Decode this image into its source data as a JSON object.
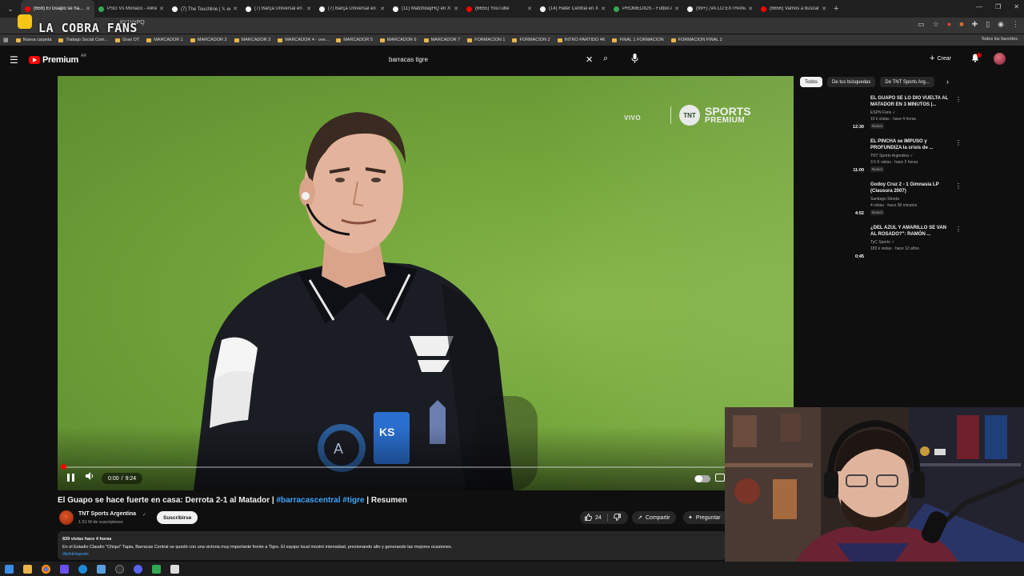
{
  "browser": {
    "tabs": [
      {
        "title": "(659) El Guapo se ha...",
        "color": "#ff0000",
        "active": true
      },
      {
        "title": "PSG Vs Monaco - Alinea...",
        "color": "#34a853"
      },
      {
        "title": "(7) The Touchline | 𝕏 en X",
        "color": "#ffffff"
      },
      {
        "title": "(7) Barça Universal en X: ...",
        "color": "#ffffff"
      },
      {
        "title": "(7) Barça Universal en X: ...",
        "color": "#ffffff"
      },
      {
        "title": "(11) MatchdayHQ en X: ...",
        "color": "#ffffff"
      },
      {
        "title": "(6655) YouTube",
        "color": "#ff0000"
      },
      {
        "title": "(14) Hater Central en X: ...",
        "color": "#ffffff"
      },
      {
        "title": "PROMEDIOS - Futbol Arg...",
        "color": "#34a853"
      },
      {
        "title": "(99+) ¡VA LO EXTRAÑAN! ...",
        "color": "#ffffff"
      },
      {
        "title": "(6656) Vamos a buscar lo...",
        "color": "#ff0000"
      }
    ],
    "url_fragment": "8Y1VzPQ",
    "overlay_logo": "LA COBRA FANS",
    "bookmarks": [
      "Nueva carpeta",
      "Trabajo Social Com...",
      "Gran DT",
      "MARCADOR 1",
      "MARCADOR 2",
      "MARCADOR 3",
      "MARCADOR 4 - ove...",
      "MARCADOR 5",
      "MARCADOR 6",
      "MARCADOR 7",
      "FORMACION 1",
      "FORMACION 2",
      "INTRO PARTIDO 4K",
      "FINAL 1 FORMACION",
      "FORMACION FINAL 2"
    ],
    "bookmarks_right": "Todos los favoritos"
  },
  "youtube": {
    "logo_word": "Premium",
    "country": "AR",
    "search_value": "barracas tigre",
    "create_label": "Crear",
    "accent": "#ff0000"
  },
  "player": {
    "overlay_vivo": "VIVO",
    "overlay_brand_disc": "TNT",
    "overlay_brand_1": "SPORTS",
    "overlay_brand_2": "PREMIUM",
    "time_current": "0:00",
    "time_sep": "/",
    "time_total": "9:24",
    "progress_fraction": 0.0
  },
  "video": {
    "title_main": "El Guapo se hace fuerte en casa: Derrota 2-1 al Matador | ",
    "title_tag1": "#barracascentral",
    "title_tag2": "#tigre",
    "title_end": " | Resumen",
    "channel": "TNT Sports Argentina",
    "verified": "✓",
    "subs": "1.51 M de suscriptores",
    "subscribe": "Suscribirse",
    "likes": "24",
    "share": "Compartir",
    "ask": "Preguntar",
    "desc_meta": "839 vistas  hace 4 horas",
    "desc_text": "En el Estadio Claudio \"Chiqui\" Tapia, Barracas Central se quedó con una victoria muy importante frente a Tigre. El equipo local mostró intensidad, presionando alto y generando las mejores ocasiones.",
    "desc_tag": "#lpfxtntsports"
  },
  "sidebar": {
    "chips": [
      "Todos",
      "De tus búsquedas",
      "De TNT Sports Arg..."
    ],
    "recs": [
      {
        "title": "EL GUAPO SE LO DIO VUELTA AL MATADOR EN 3 MINUTOS |...",
        "channel": "ESPN Fans ✓",
        "meta": "15 k vistas · hace 4 horas",
        "badge": "Nuevo",
        "dur": "12:30"
      },
      {
        "title": "EL PINCHA se IMPUSO y PROFUNDIZA la crisis de ...",
        "channel": "TNT Sports Argentina ✓",
        "meta": "3.5 K vistas · hace 2 horas",
        "badge": "Nuevo",
        "dur": "11:00"
      },
      {
        "title": "Godoy Cruz 2 - 1 Gimnasia LP (Clausura 2007)",
        "channel": "Santiago Stroda",
        "meta": "4 vistas · hace 38 minutos",
        "badge": "Nuevo",
        "dur": "4:52"
      },
      {
        "title": "¿DEL AZUL Y AMARILLO SE VAN AL ROSADO?\": RAMÓN ...",
        "channel": "TyC Sports ✓",
        "meta": "183 k vistas · hace 12 años",
        "badge": "",
        "dur": "0:45"
      }
    ]
  },
  "icons": {
    "menu": "☰",
    "search": "⌕",
    "clear": "✕",
    "mic": "🎙",
    "bell": "🔔",
    "volume": "🔊",
    "like": "👍",
    "dislike": "👎",
    "share": "↗",
    "ask": "✦",
    "next": "›",
    "kebab": "⋮"
  }
}
